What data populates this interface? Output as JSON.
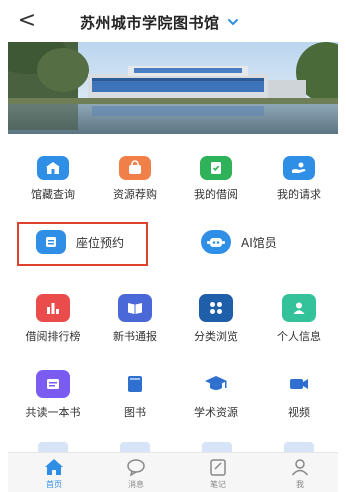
{
  "header": {
    "back_icon": "chevron-left-icon",
    "back_glyph": "<",
    "title": "苏州城市学院图书馆",
    "dropdown_icon": "chevron-down-icon"
  },
  "banner": {
    "image": "library-building-photo"
  },
  "colors": {
    "accent": "#2f8fe6",
    "highlight_border": "#e0412c",
    "blue": "#2f8fe6",
    "orange": "#f07f4a",
    "green": "#2fb35a",
    "dark_blue": "#1f5ea8",
    "red": "#ea4b4b",
    "purple": "#7a5cf0",
    "teal": "#33c29a"
  },
  "grid": {
    "row1": [
      {
        "label": "馆藏查询",
        "icon": "building-icon"
      },
      {
        "label": "资源荐购",
        "icon": "shopping-bag-icon"
      },
      {
        "label": "我的借阅",
        "icon": "book-check-icon"
      },
      {
        "label": "我的请求",
        "icon": "hand-request-icon"
      }
    ],
    "featured": [
      {
        "label": "座位预约",
        "icon": "seat-calendar-icon"
      },
      {
        "label": "AI馆员",
        "icon": "robot-icon"
      }
    ],
    "row3": [
      {
        "label": "借阅排行榜",
        "icon": "ranking-icon"
      },
      {
        "label": "新书通报",
        "icon": "new-book-icon"
      },
      {
        "label": "分类浏览",
        "icon": "category-icon"
      },
      {
        "label": "个人信息",
        "icon": "person-icon"
      }
    ],
    "row4": [
      {
        "label": "共读一本书",
        "icon": "reading-icon"
      },
      {
        "label": "图书",
        "icon": "book-icon"
      },
      {
        "label": "学术资源",
        "icon": "graduation-cap-icon"
      },
      {
        "label": "视频",
        "icon": "video-camera-icon"
      }
    ]
  },
  "tabbar": {
    "items": [
      {
        "label": "首页",
        "icon": "home-icon",
        "active": true
      },
      {
        "label": "消息",
        "icon": "message-icon",
        "active": false
      },
      {
        "label": "笔记",
        "icon": "note-icon",
        "active": false
      },
      {
        "label": "我",
        "icon": "user-icon",
        "active": false
      }
    ]
  }
}
